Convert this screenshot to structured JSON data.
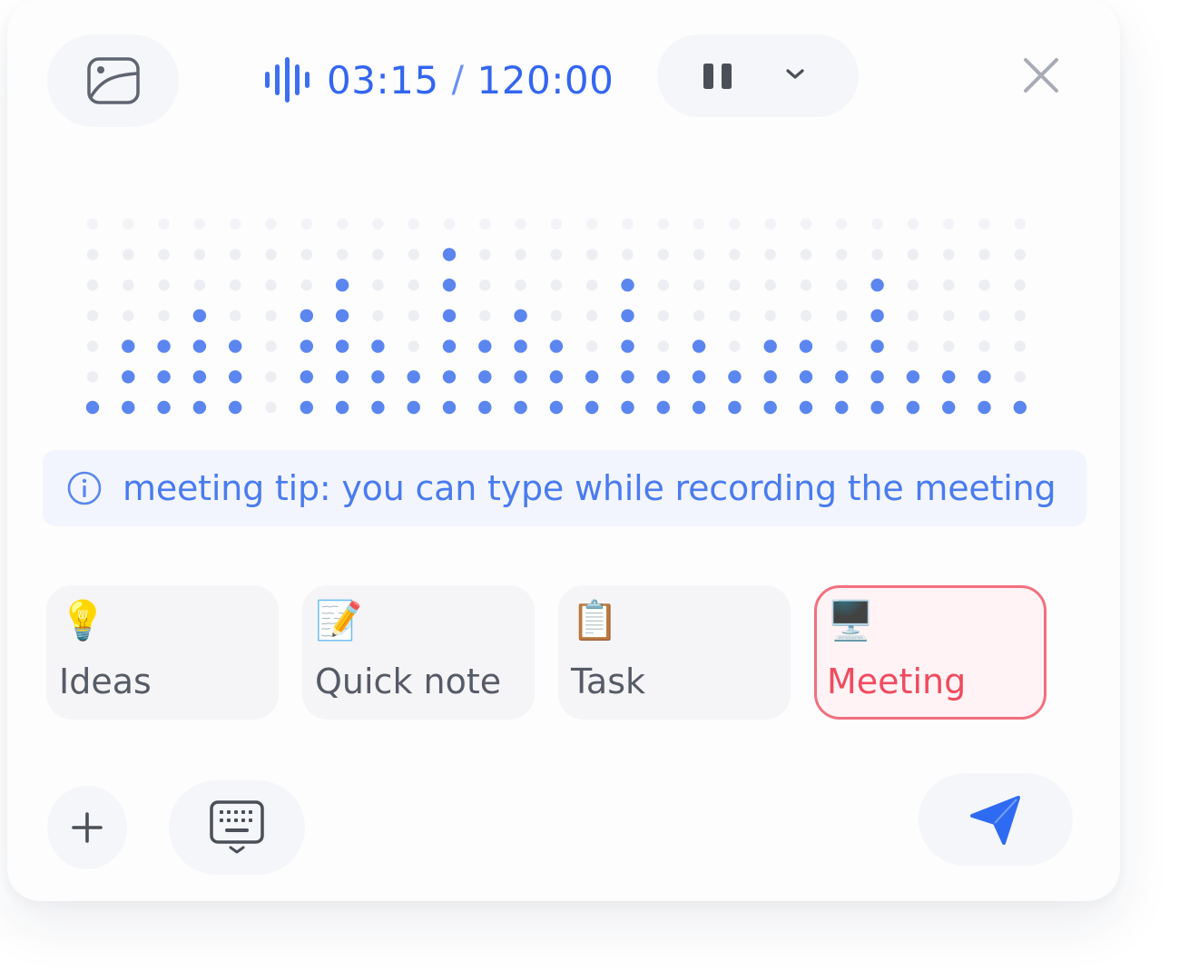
{
  "header": {
    "elapsed": "03:15",
    "separator": "/",
    "limit": "120:00",
    "icons": {
      "image": "image-icon",
      "waveform": "audio-waveform-icon",
      "pause": "pause-icon",
      "dropdown": "chevron-down-icon",
      "close": "close-icon"
    }
  },
  "visualizer": {
    "columns": 27,
    "rows": 7,
    "levels": [
      1,
      3,
      3,
      4,
      3,
      0,
      4,
      5,
      3,
      2,
      6,
      3,
      4,
      3,
      2,
      5,
      2,
      3,
      2,
      3,
      3,
      2,
      5,
      2,
      2,
      2,
      1
    ],
    "active_color": "#5b86f0",
    "inactive_color": "#eceef2"
  },
  "tip": {
    "icon": "info-icon",
    "text": "meeting tip: you can type while recording the meeting"
  },
  "categories": [
    {
      "emoji": "💡",
      "icon": "lightbulb-icon",
      "label": "Ideas",
      "selected": false
    },
    {
      "emoji": "📝",
      "icon": "memo-icon",
      "label": "Quick note",
      "selected": false
    },
    {
      "emoji": "📋",
      "icon": "clipboard-icon",
      "label": "Task",
      "selected": false
    },
    {
      "emoji": "🖥️",
      "icon": "desktop-computer-icon",
      "label": "Meeting",
      "selected": true
    }
  ],
  "footer": {
    "add_icon": "plus-icon",
    "keyboard_icon": "keyboard-icon",
    "send_icon": "send-icon"
  },
  "colors": {
    "accent": "#3366f0",
    "tip_text": "#4a7bef",
    "selected_border": "#f1707f",
    "selected_text": "#f04b5f"
  }
}
